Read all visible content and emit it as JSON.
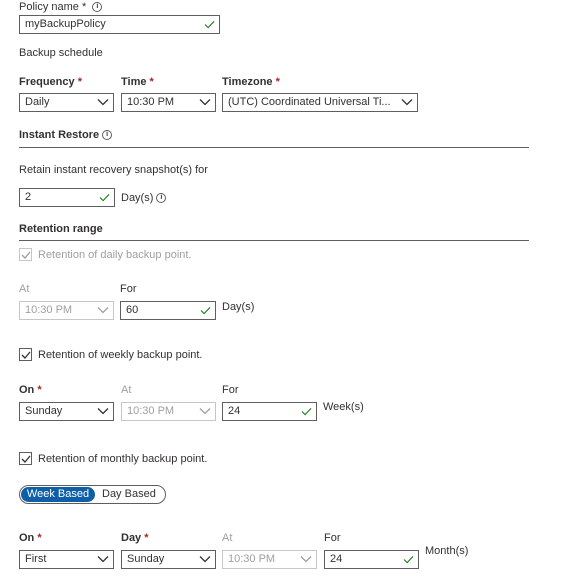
{
  "policy": {
    "label": "Policy name",
    "required_mark": " * ",
    "value": "myBackupPolicy"
  },
  "schedule": {
    "heading": "Backup schedule",
    "frequency_label": "Frequency",
    "time_label": "Time",
    "timezone_label": "Timezone",
    "required_mark": " *",
    "frequency_value": "Daily",
    "time_value": "10:30 PM",
    "timezone_value": "(UTC) Coordinated Universal Ti..."
  },
  "instant_restore": {
    "heading": "Instant Restore",
    "retain_label": "Retain instant recovery snapshot(s) for",
    "days_value": "2",
    "days_unit": "Day(s)"
  },
  "retention": {
    "heading": "Retention range",
    "daily": {
      "label": "Retention of daily backup point.",
      "checked": true,
      "disabled": true,
      "at_label": "At",
      "for_label": "For",
      "at_value": "10:30 PM",
      "for_value": "60",
      "unit": "Day(s)"
    },
    "weekly": {
      "label": "Retention of weekly backup point.",
      "checked": true,
      "on_label": "On",
      "at_label": "At",
      "for_label": "For",
      "on_value": "Sunday",
      "at_value": "10:30 PM",
      "for_value": "24",
      "unit": "Week(s)"
    },
    "monthly": {
      "label": "Retention of monthly backup point.",
      "checked": true,
      "toggle": {
        "selected": "Week Based",
        "other": "Day Based"
      },
      "on_label": "On",
      "day_label": "Day",
      "at_label": "At",
      "for_label": "For",
      "on_value": "First",
      "day_value": "Sunday",
      "at_value": "10:30 PM",
      "for_value": "24",
      "unit": "Month(s)"
    }
  },
  "colors": {
    "accent": "#0f5fa8",
    "check": "#107c10",
    "required": "#a4262c",
    "disabled": "#a19f9d"
  }
}
